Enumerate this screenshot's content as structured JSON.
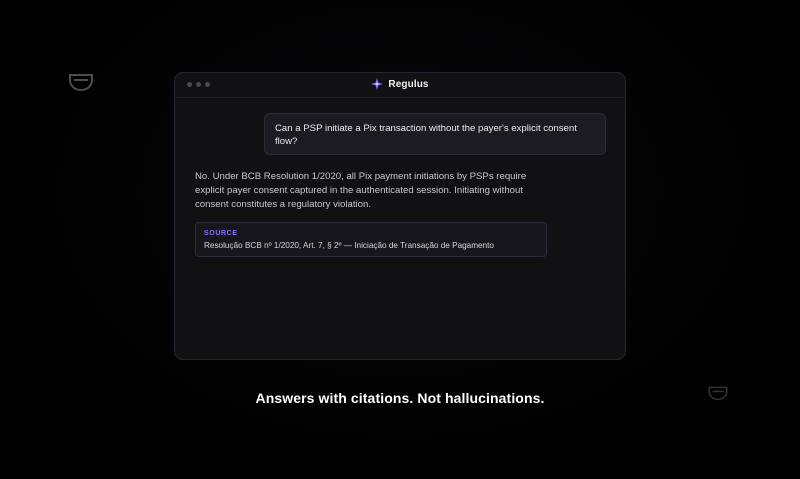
{
  "app": {
    "title": "Regulus",
    "icon": "sparkle-icon",
    "accent_color": "#8c6dfd"
  },
  "conversation": {
    "user_message": "Can a PSP initiate a Pix transaction without the payer's explicit consent flow?",
    "assistant_message": "No. Under BCB Resolution 1/2020, all Pix payment initiations by PSPs require explicit payer consent captured in the authenticated session. Initiating without consent constitutes a regulatory violation.",
    "source": {
      "label": "SOURCE",
      "citation": "Resolução BCB nº 1/2020, Art. 7, § 2º — Iniciação de Transação de Pagamento"
    }
  },
  "tagline": "Answers with citations. Not hallucinations."
}
